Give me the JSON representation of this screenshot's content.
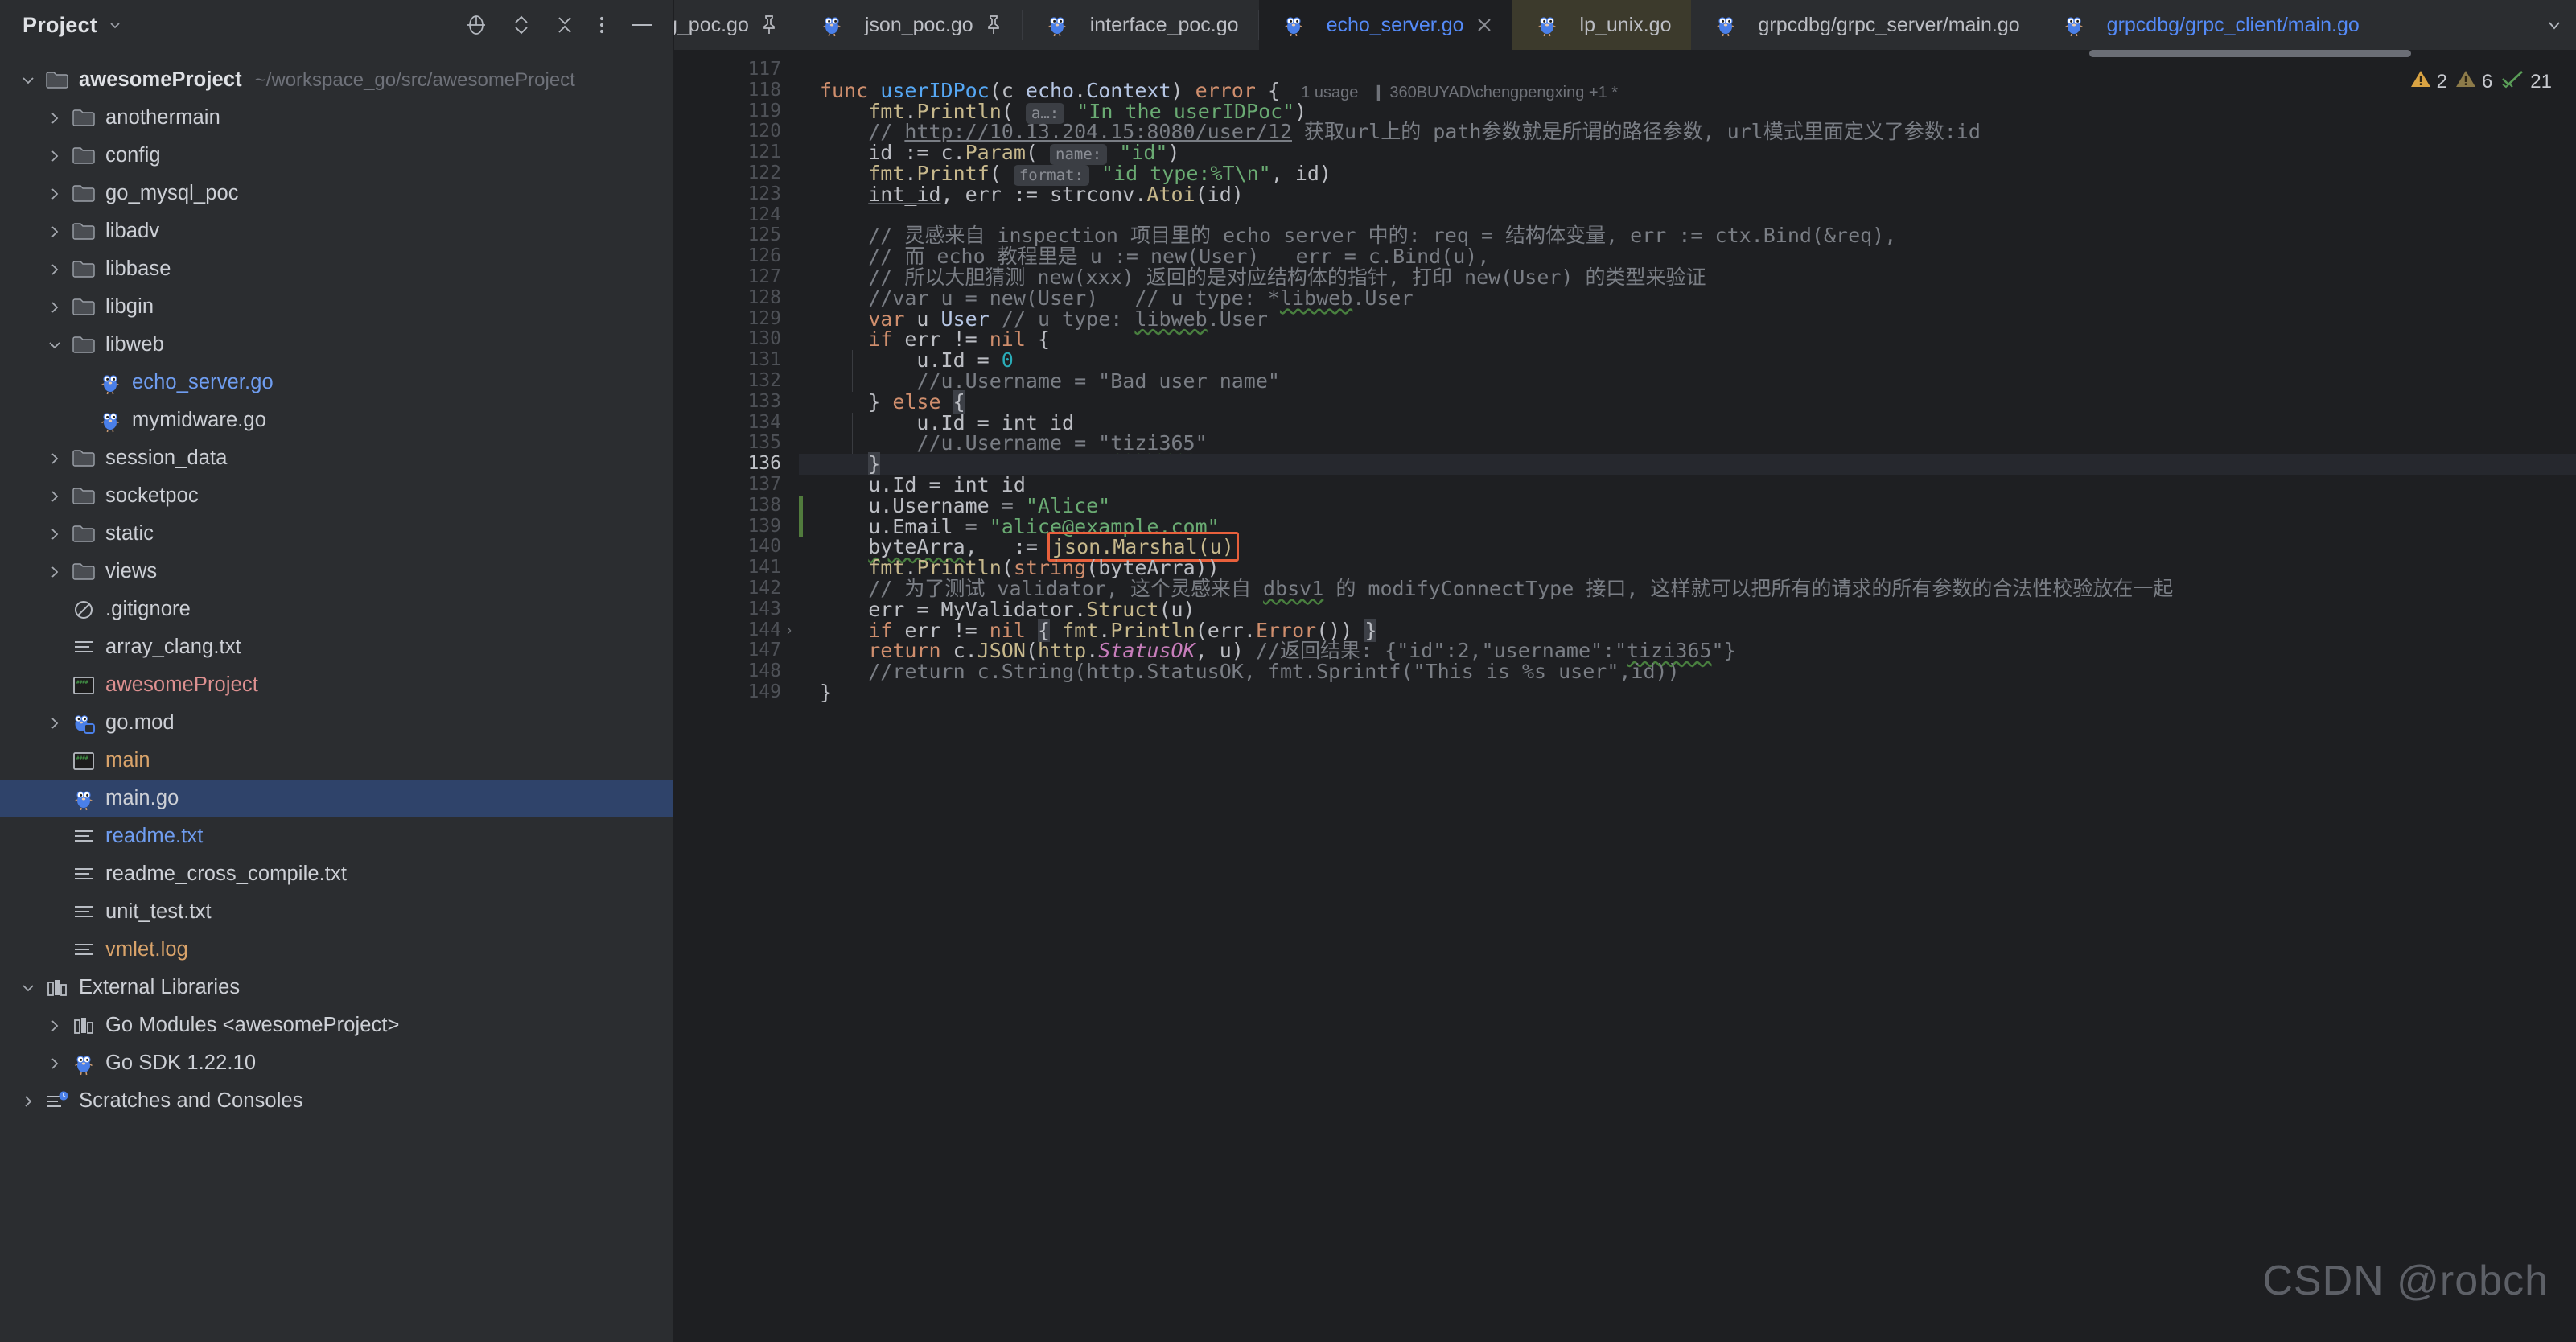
{
  "sidebar": {
    "title": "Project",
    "tools": [
      "locate-icon",
      "expand-collapse-icon",
      "collapse-all-icon",
      "more-options-icon",
      "hide-icon"
    ],
    "project_root": {
      "label": "awesomeProject",
      "path": "~/workspace_go/src/awesomeProject"
    },
    "items": [
      {
        "label": "anothermain",
        "indent": 1,
        "icon": "folder-icon",
        "twisty": "right",
        "color": ""
      },
      {
        "label": "config",
        "indent": 1,
        "icon": "folder-icon",
        "twisty": "right",
        "color": ""
      },
      {
        "label": "go_mysql_poc",
        "indent": 1,
        "icon": "folder-icon",
        "twisty": "right",
        "color": ""
      },
      {
        "label": "libadv",
        "indent": 1,
        "icon": "folder-icon",
        "twisty": "right",
        "color": ""
      },
      {
        "label": "libbase",
        "indent": 1,
        "icon": "folder-icon",
        "twisty": "right",
        "color": ""
      },
      {
        "label": "libgin",
        "indent": 1,
        "icon": "folder-icon",
        "twisty": "right",
        "color": ""
      },
      {
        "label": "libweb",
        "indent": 1,
        "icon": "folder-icon",
        "twisty": "down",
        "color": ""
      },
      {
        "label": "echo_server.go",
        "indent": 2,
        "icon": "go-file-icon",
        "twisty": "none",
        "color": "blue"
      },
      {
        "label": "mymidware.go",
        "indent": 2,
        "icon": "go-file-icon",
        "twisty": "none",
        "color": ""
      },
      {
        "label": "session_data",
        "indent": 1,
        "icon": "folder-icon",
        "twisty": "right",
        "color": ""
      },
      {
        "label": "socketpoc",
        "indent": 1,
        "icon": "folder-icon",
        "twisty": "right",
        "color": ""
      },
      {
        "label": "static",
        "indent": 1,
        "icon": "folder-icon",
        "twisty": "right",
        "color": ""
      },
      {
        "label": "views",
        "indent": 1,
        "icon": "folder-icon",
        "twisty": "right",
        "color": ""
      },
      {
        "label": ".gitignore",
        "indent": 1,
        "icon": "gitignore-icon",
        "twisty": "none",
        "color": ""
      },
      {
        "label": "array_clang.txt",
        "indent": 1,
        "icon": "text-file-icon",
        "twisty": "none",
        "color": ""
      },
      {
        "label": "awesomeProject",
        "indent": 1,
        "icon": "binary-icon",
        "twisty": "none",
        "color": "salmon"
      },
      {
        "label": "go.mod",
        "indent": 1,
        "icon": "go-mod-icon",
        "twisty": "right",
        "color": ""
      },
      {
        "label": "main",
        "indent": 1,
        "icon": "binary-icon",
        "twisty": "none",
        "color": "orange"
      },
      {
        "label": "main.go",
        "indent": 1,
        "icon": "go-file-icon",
        "twisty": "none",
        "color": "",
        "selected": true
      },
      {
        "label": "readme.txt",
        "indent": 1,
        "icon": "text-file-icon",
        "twisty": "none",
        "color": "blue"
      },
      {
        "label": "readme_cross_compile.txt",
        "indent": 1,
        "icon": "text-file-icon",
        "twisty": "none",
        "color": ""
      },
      {
        "label": "unit_test.txt",
        "indent": 1,
        "icon": "text-file-icon",
        "twisty": "none",
        "color": ""
      },
      {
        "label": "vmlet.log",
        "indent": 1,
        "icon": "text-file-icon",
        "twisty": "none",
        "color": "orange"
      },
      {
        "label": "External Libraries",
        "indent": 0,
        "icon": "library-icon",
        "twisty": "down",
        "color": ""
      },
      {
        "label": "Go Modules <awesomeProject>",
        "indent": 1,
        "icon": "library-icon",
        "twisty": "right",
        "color": ""
      },
      {
        "label": "Go SDK 1.22.10",
        "indent": 1,
        "icon": "go-file-icon",
        "twisty": "right",
        "color": ""
      },
      {
        "label": "Scratches and Consoles",
        "indent": 0,
        "icon": "scratches-icon",
        "twisty": "right",
        "color": ""
      }
    ]
  },
  "tabs": [
    {
      "label": "g_poc.go",
      "icon": "go-file-icon",
      "pinned": true,
      "active": false,
      "clipped": true
    },
    {
      "label": "json_poc.go",
      "icon": "go-file-icon",
      "pinned": true,
      "active": false
    },
    {
      "label": "interface_poc.go",
      "icon": "go-file-icon",
      "pinned": false,
      "active": false
    },
    {
      "label": "echo_server.go",
      "icon": "go-file-icon",
      "pinned": false,
      "active": true,
      "closable": true
    },
    {
      "label": "lp_unix.go",
      "icon": "go-file-icon",
      "pinned": false,
      "active": false,
      "highlight": true
    },
    {
      "label": "grpcdbg/grpc_server/main.go",
      "icon": "go-file-icon",
      "pinned": false,
      "active": false
    },
    {
      "label": "grpcdbg/grpc_client/main.go",
      "icon": "go-file-icon",
      "pinned": false,
      "active": false,
      "blue": true
    }
  ],
  "tab_overflow_icon": "chevron-down-icon",
  "inspections": {
    "warnings_icon": "warning-triangle-icon",
    "warnings": "2",
    "weak_warnings_icon": "weak-warning-triangle-icon",
    "weak_warnings": "6",
    "ok_icon": "checkmark-icon",
    "typos": "21"
  },
  "editor": {
    "watermark": "CSDN @robch",
    "current_line": 136,
    "line_numbers": [
      117,
      118,
      119,
      120,
      121,
      122,
      123,
      124,
      125,
      126,
      127,
      128,
      129,
      130,
      131,
      132,
      133,
      134,
      135,
      136,
      137,
      138,
      139,
      140,
      141,
      142,
      143,
      144,
      147,
      148,
      149
    ],
    "folded_lines": [
      144
    ],
    "code_lines": [
      {
        "n": 117,
        "segments": []
      },
      {
        "n": 118,
        "segments": [
          {
            "t": "func ",
            "c": "kw"
          },
          {
            "t": "userIDPoc",
            "c": "fn"
          },
          {
            "t": "(c ",
            "c": "pln"
          },
          {
            "t": "echo",
            "c": "typ"
          },
          {
            "t": ".",
            "c": "pln"
          },
          {
            "t": "Context",
            "c": "typ"
          },
          {
            "t": ") ",
            "c": "pln"
          },
          {
            "t": "error",
            "c": "kw"
          },
          {
            "t": " { ",
            "c": "pln"
          },
          {
            "t": "  1 usage",
            "c": "usage"
          },
          {
            "t": "   ❙ 360BUYAD\\chengpengxing +1 *",
            "c": "usage"
          }
        ]
      },
      {
        "n": 119,
        "segments": [
          {
            "t": "    ",
            "c": "pln"
          },
          {
            "t": "fmt",
            "c": "fnc"
          },
          {
            "t": ".",
            "c": "pln"
          },
          {
            "t": "Println",
            "c": "fnc"
          },
          {
            "t": "( ",
            "c": "pln"
          },
          {
            "t": "a…:",
            "c": "hint"
          },
          {
            "t": " ",
            "c": "pln"
          },
          {
            "t": "\"In the userIDPoc\"",
            "c": "str"
          },
          {
            "t": ")",
            "c": "pln"
          }
        ]
      },
      {
        "n": 120,
        "segments": [
          {
            "t": "    // ",
            "c": "cmt"
          },
          {
            "t": "http://10.13.204.15:8080/user/12",
            "c": "lnk"
          },
          {
            "t": " 获取url上的 path参数就是所谓的路径参数, url模式里面定义了参数:id",
            "c": "cmt"
          }
        ]
      },
      {
        "n": 121,
        "segments": [
          {
            "t": "    id := c.",
            "c": "pln"
          },
          {
            "t": "Param",
            "c": "fnc"
          },
          {
            "t": "( ",
            "c": "pln"
          },
          {
            "t": "name:",
            "c": "hint"
          },
          {
            "t": " ",
            "c": "pln"
          },
          {
            "t": "\"id\"",
            "c": "str"
          },
          {
            "t": ")",
            "c": "pln"
          }
        ]
      },
      {
        "n": 122,
        "segments": [
          {
            "t": "    ",
            "c": "pln"
          },
          {
            "t": "fmt",
            "c": "fnc"
          },
          {
            "t": ".",
            "c": "pln"
          },
          {
            "t": "Printf",
            "c": "fnc"
          },
          {
            "t": "( ",
            "c": "pln"
          },
          {
            "t": "format:",
            "c": "hint"
          },
          {
            "t": " ",
            "c": "pln"
          },
          {
            "t": "\"id type:%T\\n\"",
            "c": "str"
          },
          {
            "t": ", id)",
            "c": "pln"
          }
        ]
      },
      {
        "n": 123,
        "segments": [
          {
            "t": "    ",
            "c": "pln"
          },
          {
            "t": "int_id",
            "c": "ident"
          },
          {
            "t": ", err := strconv.",
            "c": "pln"
          },
          {
            "t": "Atoi",
            "c": "fnc"
          },
          {
            "t": "(id)",
            "c": "pln"
          }
        ]
      },
      {
        "n": 124,
        "segments": []
      },
      {
        "n": 125,
        "segments": [
          {
            "t": "    // 灵感来自 inspection 项目里的 echo server 中的: req = 结构体变量, err := ctx.Bind(&req),",
            "c": "cmt"
          }
        ]
      },
      {
        "n": 126,
        "segments": [
          {
            "t": "    // 而 echo 教程里是 u := new(User)   err = c.Bind(u),",
            "c": "cmt"
          }
        ]
      },
      {
        "n": 127,
        "segments": [
          {
            "t": "    // 所以大胆猜测 new(xxx) 返回的是对应结构体的指针, 打印 new(User) 的类型来验证",
            "c": "cmt"
          }
        ]
      },
      {
        "n": 128,
        "segments": [
          {
            "t": "    //var u = new(User)   // u type: *",
            "c": "cmt"
          },
          {
            "t": "libweb",
            "c": "cmt wavy"
          },
          {
            "t": ".User",
            "c": "cmt"
          }
        ]
      },
      {
        "n": 129,
        "segments": [
          {
            "t": "    ",
            "c": "pln"
          },
          {
            "t": "var",
            "c": "kw"
          },
          {
            "t": " u ",
            "c": "pln"
          },
          {
            "t": "User",
            "c": "typ"
          },
          {
            "t": " // u type: ",
            "c": "cmt"
          },
          {
            "t": "libweb",
            "c": "cmt wavy"
          },
          {
            "t": ".User",
            "c": "cmt"
          }
        ]
      },
      {
        "n": 130,
        "segments": [
          {
            "t": "    ",
            "c": "pln"
          },
          {
            "t": "if",
            "c": "kw"
          },
          {
            "t": " err != ",
            "c": "pln"
          },
          {
            "t": "nil",
            "c": "kw"
          },
          {
            "t": " {",
            "c": "pln"
          }
        ]
      },
      {
        "n": 131,
        "segments": [
          {
            "t": "        u.Id = ",
            "c": "pln"
          },
          {
            "t": "0",
            "c": "num"
          }
        ]
      },
      {
        "n": 132,
        "segments": [
          {
            "t": "        //u.Username = \"Bad user name\"",
            "c": "cmt"
          }
        ]
      },
      {
        "n": 133,
        "segments": [
          {
            "t": "    } ",
            "c": "pln"
          },
          {
            "t": "else",
            "c": "kw"
          },
          {
            "t": " ",
            "c": "pln"
          },
          {
            "t": "{",
            "c": "pln brace-hl"
          }
        ]
      },
      {
        "n": 134,
        "segments": [
          {
            "t": "        u.Id = int_id",
            "c": "pln"
          }
        ]
      },
      {
        "n": 135,
        "segments": [
          {
            "t": "        //u.Username = \"",
            "c": "cmt"
          },
          {
            "t": "tizi365",
            "c": "cmt wavy"
          },
          {
            "t": "\"",
            "c": "cmt"
          }
        ]
      },
      {
        "n": 136,
        "segments": [
          {
            "t": "    ",
            "c": "pln"
          },
          {
            "t": "}",
            "c": "pln brace-hl"
          }
        ]
      },
      {
        "n": 137,
        "segments": [
          {
            "t": "    u.Id = int_id",
            "c": "pln"
          }
        ]
      },
      {
        "n": 138,
        "segments": [
          {
            "t": "    u.Username = ",
            "c": "pln"
          },
          {
            "t": "\"Alice\"",
            "c": "str"
          }
        ]
      },
      {
        "n": 139,
        "segments": [
          {
            "t": "    u.Email = ",
            "c": "pln"
          },
          {
            "t": "\"alice@example.com\"",
            "c": "str"
          }
        ]
      },
      {
        "n": 140,
        "segments": [
          {
            "t": "    ",
            "c": "pln"
          },
          {
            "t": "byteArra",
            "c": "pln wavy"
          },
          {
            "t": ", _ := ",
            "c": "pln"
          },
          {
            "t": "json.Marshal(u)",
            "c": "fnc redbox"
          }
        ]
      },
      {
        "n": 141,
        "segments": [
          {
            "t": "    ",
            "c": "pln"
          },
          {
            "t": "fmt",
            "c": "fnc"
          },
          {
            "t": ".",
            "c": "pln"
          },
          {
            "t": "Println",
            "c": "fnc"
          },
          {
            "t": "(",
            "c": "pln"
          },
          {
            "t": "string",
            "c": "kw"
          },
          {
            "t": "(byteArra))",
            "c": "pln"
          }
        ]
      },
      {
        "n": 142,
        "segments": [
          {
            "t": "    // 为了测试 validator, 这个灵感来自 ",
            "c": "cmt"
          },
          {
            "t": "dbsv1",
            "c": "cmt wavy"
          },
          {
            "t": " 的 modifyConnectType 接口, 这样就可以把所有的请求的所有参数的合法性校验放在一起",
            "c": "cmt"
          }
        ]
      },
      {
        "n": 143,
        "segments": [
          {
            "t": "    err = MyValidator.",
            "c": "pln"
          },
          {
            "t": "Struct",
            "c": "fnc"
          },
          {
            "t": "(u)",
            "c": "pln"
          }
        ]
      },
      {
        "n": 144,
        "segments": [
          {
            "t": "    ",
            "c": "pln"
          },
          {
            "t": "if",
            "c": "kw"
          },
          {
            "t": " err != ",
            "c": "pln"
          },
          {
            "t": "nil",
            "c": "kw"
          },
          {
            "t": " ",
            "c": "pln"
          },
          {
            "t": "{",
            "c": "pln brace-hl"
          },
          {
            "t": " ",
            "c": "pln"
          },
          {
            "t": "fmt",
            "c": "fnc"
          },
          {
            "t": ".",
            "c": "pln"
          },
          {
            "t": "Println",
            "c": "fnc"
          },
          {
            "t": "(err.",
            "c": "pln"
          },
          {
            "t": "Error",
            "c": "kw"
          },
          {
            "t": "()) ",
            "c": "pln"
          },
          {
            "t": "}",
            "c": "pln brace-hl"
          }
        ]
      },
      {
        "n": 147,
        "segments": [
          {
            "t": "    ",
            "c": "pln"
          },
          {
            "t": "return",
            "c": "kw"
          },
          {
            "t": " c.",
            "c": "pln"
          },
          {
            "t": "JSON",
            "c": "fnc"
          },
          {
            "t": "(",
            "c": "pln"
          },
          {
            "t": "http",
            "c": "fnc"
          },
          {
            "t": ".",
            "c": "pln"
          },
          {
            "t": "StatusOK",
            "c": "stat"
          },
          {
            "t": ", u) ",
            "c": "pln"
          },
          {
            "t": "//返回结果: {\"id\":2,\"username\":\"",
            "c": "cmt"
          },
          {
            "t": "tizi365",
            "c": "cmt wavy"
          },
          {
            "t": "\"}",
            "c": "cmt"
          }
        ]
      },
      {
        "n": 148,
        "segments": [
          {
            "t": "    //return c.String(http.StatusOK, fmt.Sprintf(\"This is %s user\",id))",
            "c": "cmt"
          }
        ]
      },
      {
        "n": 149,
        "segments": [
          {
            "t": "}",
            "c": "pln"
          }
        ]
      }
    ]
  },
  "colors": {
    "sidebar_bg": "#2b2d30",
    "editor_bg": "#1e1f22",
    "selection_blue": "#2f436a",
    "accent_blue": "#548af7",
    "highlight_red": "#e8603c",
    "tab_highlight": "#3c3a2c",
    "current_line": "#26282e",
    "change_marker_green": "#517b3d"
  }
}
